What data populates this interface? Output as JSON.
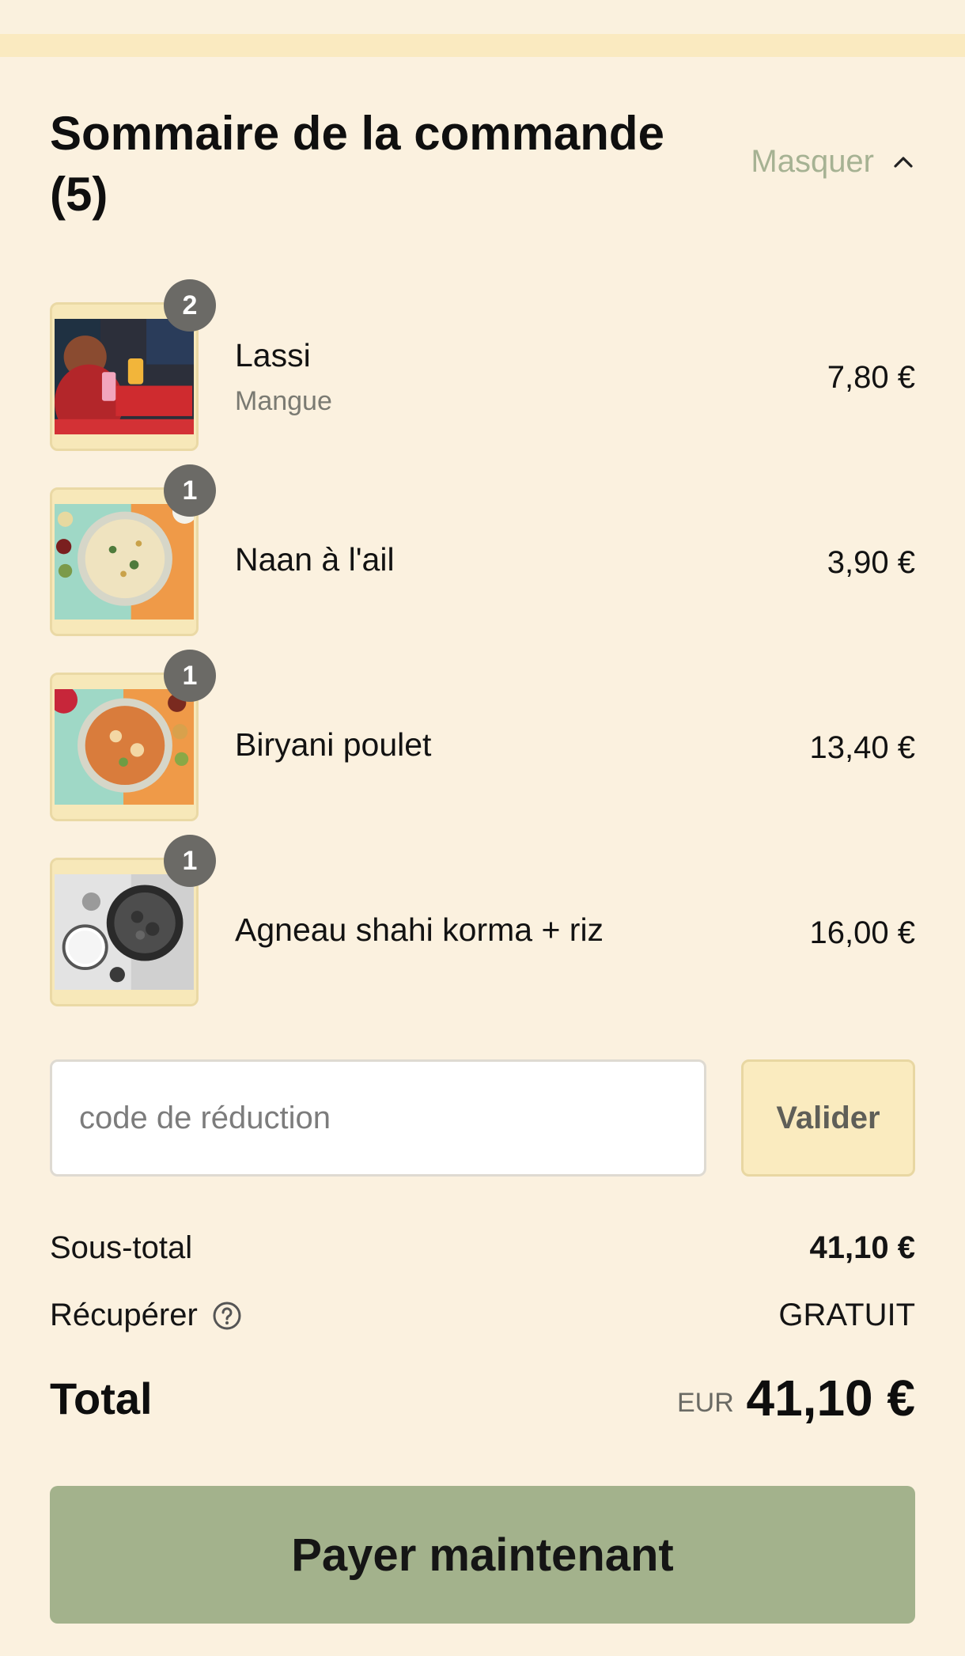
{
  "summary": {
    "title": "Sommaire de la commande (5)",
    "toggle_label": "Masquer",
    "toggle_icon": "chevron-up-icon"
  },
  "items": [
    {
      "name": "Lassi",
      "variant": "Mangue",
      "price": "7,80 €",
      "quantity": "2",
      "image_icon": "lassi-poster-image"
    },
    {
      "name": "Naan à l'ail",
      "variant": "",
      "price": "3,90 €",
      "quantity": "1",
      "image_icon": "garlic-naan-image"
    },
    {
      "name": "Biryani poulet",
      "variant": "",
      "price": "13,40 €",
      "quantity": "1",
      "image_icon": "chicken-biryani-image"
    },
    {
      "name": "Agneau shahi korma + riz",
      "variant": "",
      "price": "16,00 €",
      "quantity": "1",
      "image_icon": "lamb-korma-rice-image"
    }
  ],
  "discount": {
    "placeholder": "code de réduction",
    "value": "",
    "button_label": "Valider"
  },
  "totals": {
    "subtotal_label": "Sous-total",
    "subtotal_value": "41,10 €",
    "pickup_label": "Récupérer",
    "pickup_value": "GRATUIT",
    "pickup_icon": "help-circle-icon",
    "total_label": "Total",
    "currency": "EUR",
    "total_value": "41,10 €"
  },
  "pay_button_label": "Payer maintenant",
  "colors": {
    "background": "#fbf1df",
    "strip": "#faeac0",
    "accent_green": "#a3b28c",
    "muted_green_text": "#a6b293",
    "badge": "#6b6a66"
  }
}
